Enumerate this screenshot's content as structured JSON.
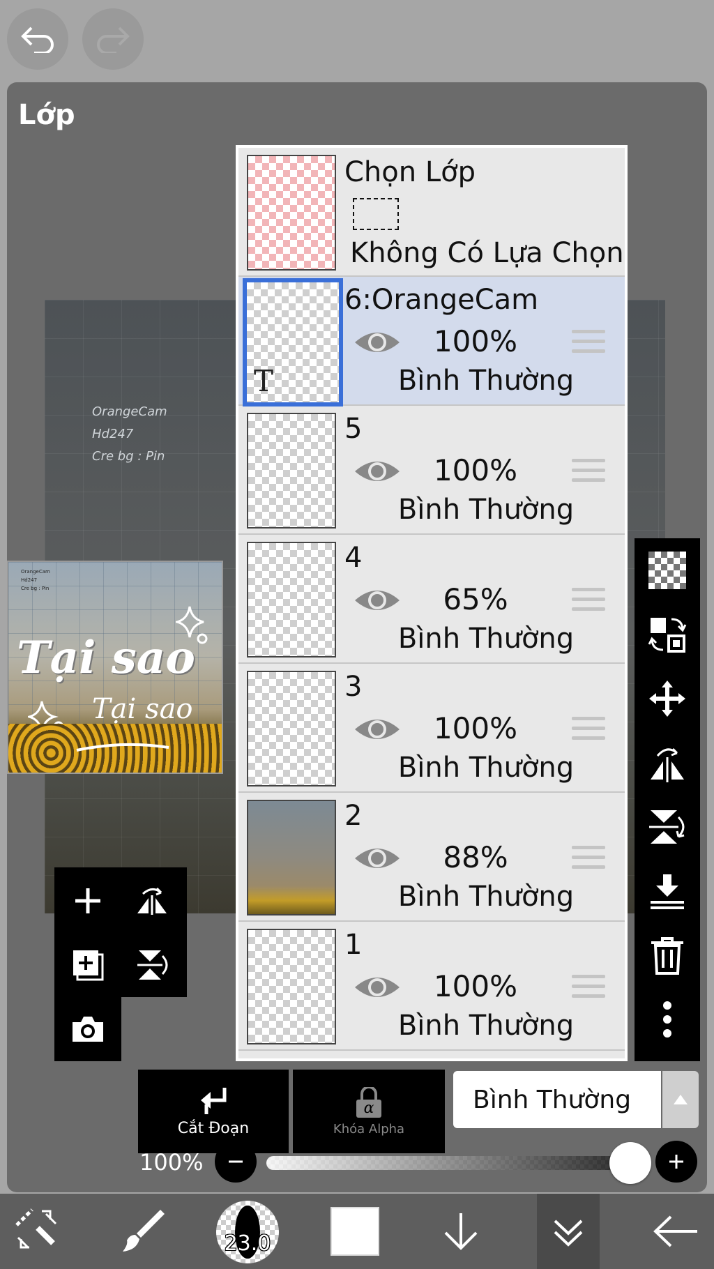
{
  "panel": {
    "title": "Lớp"
  },
  "canvas": {
    "credits": [
      "OrangeCam",
      "Hd247",
      "Cre bg : Pin"
    ]
  },
  "preview": {
    "credits": [
      "OrangeCam",
      "Hd247",
      "Cre bg : Pin"
    ],
    "big_text": "Tại sao",
    "small_text": "Tại sao"
  },
  "selection_layer": {
    "title": "Chọn Lớp",
    "subtitle": "Không Có Lựa Chọn"
  },
  "layers": [
    {
      "name": "6:OrangeCam",
      "opacity": "100%",
      "blend": "Bình Thường",
      "selected": true,
      "type_glyph": "T"
    },
    {
      "name": "5",
      "opacity": "100%",
      "blend": "Bình Thường",
      "selected": false
    },
    {
      "name": "4",
      "opacity": "65%",
      "blend": "Bình Thường",
      "selected": false
    },
    {
      "name": "3",
      "opacity": "100%",
      "blend": "Bình Thường",
      "selected": false
    },
    {
      "name": "2",
      "opacity": "88%",
      "blend": "Bình Thường",
      "selected": false
    },
    {
      "name": "1",
      "opacity": "100%",
      "blend": "Bình Thường",
      "selected": false
    }
  ],
  "bottom_controls": {
    "clip_label": "Cắt Đoạn",
    "alpha_lock_label": "Khóa Alpha",
    "alpha_glyph": "α",
    "blend_mode": "Bình Thường",
    "opacity_label": "100%",
    "opacity_value": 1.0
  },
  "toolbar": {
    "brush_size": "23.0"
  },
  "colors": {
    "accent": "#3a6fd8",
    "selected_row": "#d3dbec",
    "panel_bg": "#6b6b6b"
  }
}
